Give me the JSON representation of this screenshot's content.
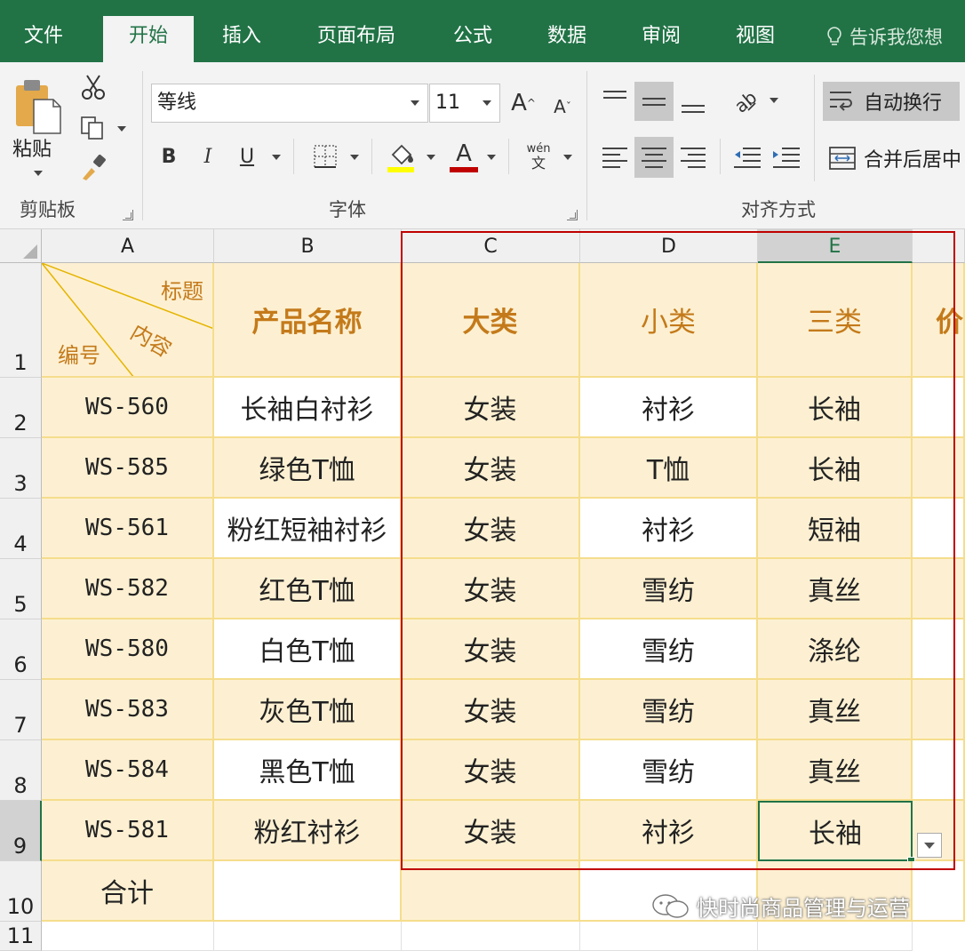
{
  "tabs": [
    "文件",
    "开始",
    "插入",
    "页面布局",
    "公式",
    "数据",
    "审阅",
    "视图"
  ],
  "tell_me": "告诉我您想",
  "ribbon": {
    "clipboard": {
      "paste_label": "粘贴",
      "group_label": "剪贴板"
    },
    "font": {
      "font_name": "等线",
      "font_size": "11",
      "bold": "B",
      "italic": "I",
      "underline": "U",
      "font_color_glyph": "A",
      "grow_glyph": "A",
      "shrink_glyph": "A",
      "phonetic_top": "wén",
      "phonetic_bottom": "文",
      "group_label": "字体"
    },
    "alignment": {
      "wrap_text": "自动换行",
      "merge_center": "合并后居中",
      "group_label": "对齐方式"
    }
  },
  "colors": {
    "accent": "#217346",
    "cell_fill": "#fdf0d2",
    "cell_border": "#f5dd8c",
    "header_text": "#c47a1a",
    "selection_box": "#c00000"
  },
  "grid": {
    "columns": [
      "A",
      "B",
      "C",
      "D",
      "E"
    ],
    "rows": [
      "1",
      "2",
      "3",
      "4",
      "5",
      "6",
      "7",
      "8",
      "9",
      "10",
      "11"
    ],
    "diag_header": {
      "top_right": "标题",
      "middle": "内容",
      "bottom_left": "编号"
    },
    "header_row": {
      "b": "产品名称",
      "c": "大类",
      "d": "小类",
      "e": "三类",
      "f": "价"
    },
    "data": [
      {
        "id": "WS-560",
        "name": "长袖白衬衫",
        "cat": "女装",
        "sub": "衬衫",
        "third": "长袖"
      },
      {
        "id": "WS-585",
        "name": "绿色T恤",
        "cat": "女装",
        "sub": "T恤",
        "third": "长袖"
      },
      {
        "id": "WS-561",
        "name": "粉红短袖衬衫",
        "cat": "女装",
        "sub": "衬衫",
        "third": "短袖"
      },
      {
        "id": "WS-582",
        "name": "红色T恤",
        "cat": "女装",
        "sub": "雪纺",
        "third": "真丝"
      },
      {
        "id": "WS-580",
        "name": "白色T恤",
        "cat": "女装",
        "sub": "雪纺",
        "third": "涤纶"
      },
      {
        "id": "WS-583",
        "name": "灰色T恤",
        "cat": "女装",
        "sub": "雪纺",
        "third": "真丝"
      },
      {
        "id": "WS-584",
        "name": "黑色T恤",
        "cat": "女装",
        "sub": "雪纺",
        "third": "真丝"
      },
      {
        "id": "WS-581",
        "name": "粉红衬衫",
        "cat": "女装",
        "sub": "衬衫",
        "third": "长袖"
      }
    ],
    "total_label": "合计"
  },
  "watermark": "快时尚商品管理与运营"
}
